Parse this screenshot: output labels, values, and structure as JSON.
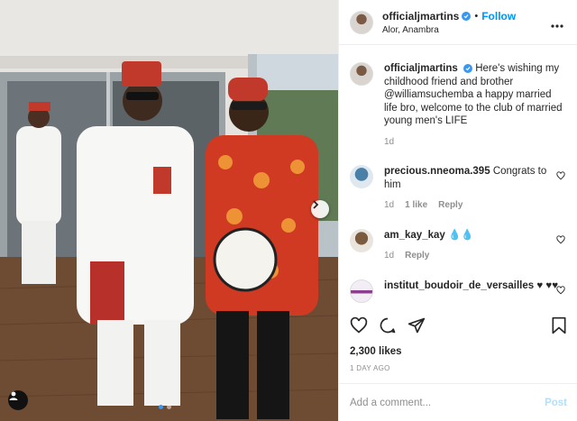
{
  "header": {
    "username": "officialjmartins",
    "separator": "•",
    "follow_label": "Follow",
    "location": "Alor, Anambra"
  },
  "caption": {
    "username": "officialjmartins",
    "text": "Here's wishing my childhood friend and brother @williamsuchemba a happy married life bro, welcome to the club of married young men's LIFE",
    "age": "1d"
  },
  "comments": [
    {
      "username": "precious.nneoma.395",
      "text": "Congrats to him",
      "age": "1d",
      "likes": "1 like",
      "reply": "Reply"
    },
    {
      "username": "am_kay_kay",
      "text": "💧💧",
      "age": "1d",
      "reply": "Reply"
    },
    {
      "username": "institut_boudoir_de_versailles",
      "text": "♥ ♥♥"
    }
  ],
  "engagement": {
    "likes": "2,300 likes",
    "date": "1 DAY AGO"
  },
  "add_comment": {
    "placeholder": "Add a comment...",
    "post_label": "Post"
  },
  "icons": {
    "verified": "verified-badge-icon",
    "more": "more-options-icon",
    "heart": "heart-icon",
    "comment": "comment-icon",
    "share": "share-icon",
    "save": "bookmark-icon",
    "next": "chevron-right-icon",
    "tag": "user-tag-icon"
  },
  "colors": {
    "accent": "#0095f6",
    "verified": "#3897f0",
    "muted": "#8e8e8e",
    "post_disabled": "#b2dffc"
  },
  "carousel": {
    "total": 2,
    "active": 1
  }
}
